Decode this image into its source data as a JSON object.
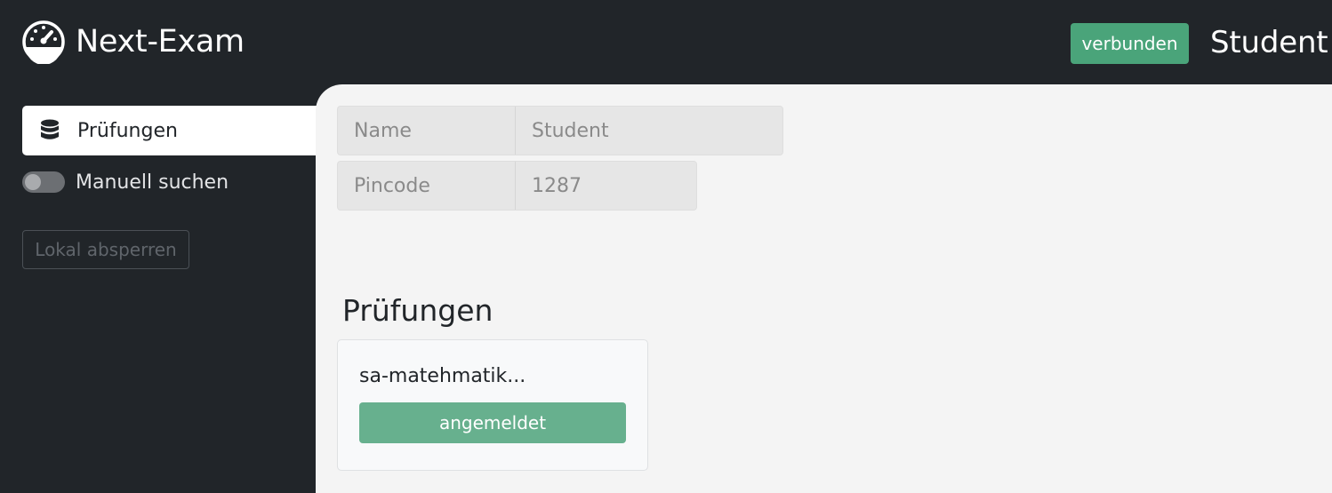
{
  "header": {
    "app_title": "Next-Exam",
    "status_badge": "verbunden",
    "user_name": "Student",
    "logo_icon": "speedometer-icon"
  },
  "sidebar": {
    "nav_item": {
      "label": "Prüfungen",
      "icon": "database-icon"
    },
    "toggle": {
      "label": "Manuell suchen",
      "on": false
    },
    "lock_button": "Lokal absperren"
  },
  "main": {
    "fields": [
      {
        "label": "Name",
        "value": "Student"
      },
      {
        "label": "Pincode",
        "value": "1287"
      }
    ],
    "section_title": "Prüfungen",
    "exams": [
      {
        "name": "sa-matehmatik...",
        "status": "angemeldet"
      }
    ]
  },
  "colors": {
    "background_dark": "#212529",
    "panel": "#f4f4f4",
    "success": "#4aa47a",
    "registered": "#67b08e"
  }
}
